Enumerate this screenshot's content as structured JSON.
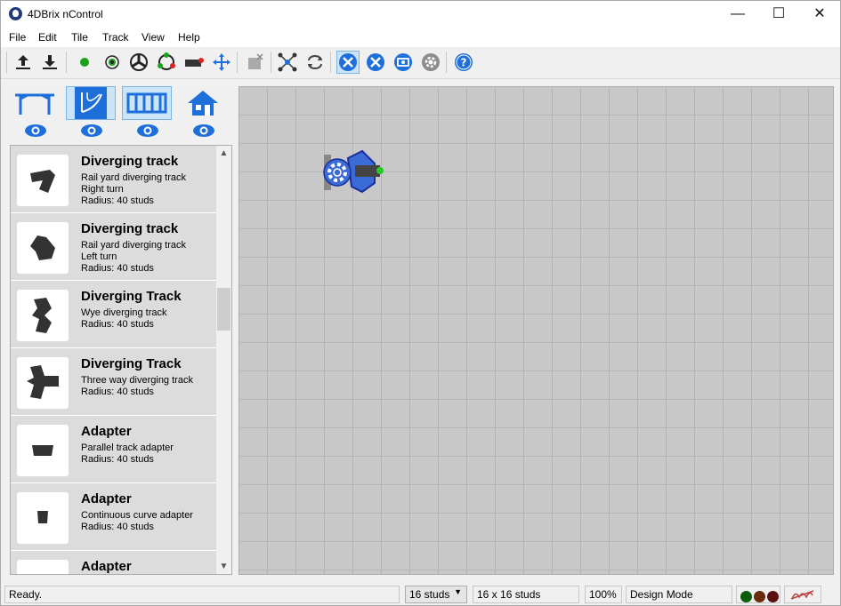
{
  "window": {
    "title": "4DBrix nControl",
    "minimize": "—",
    "maximize": "☐",
    "close": "✕"
  },
  "menu": {
    "file": "File",
    "edit": "Edit",
    "tile": "Tile",
    "track": "Track",
    "view": "View",
    "help": "Help"
  },
  "toolbar": {
    "icons": [
      "upload-icon",
      "download-icon",
      "green-dot-icon",
      "sensor-icon",
      "turntable-icon",
      "loop-icon",
      "train-icon",
      "move-icon",
      "delete-icon",
      "network-icon",
      "cycle-icon",
      "design-mode-icon",
      "tools-icon",
      "screen-icon",
      "settings-icon",
      "help-icon"
    ]
  },
  "categories": [
    {
      "name": "bridges",
      "selected": false
    },
    {
      "name": "curves",
      "selected": true
    },
    {
      "name": "straights",
      "selected": true
    },
    {
      "name": "buildings",
      "selected": false
    }
  ],
  "tiles": [
    {
      "title": "Diverging track",
      "line1": "Rail yard diverging track",
      "line2": "Right turn",
      "line3": "Radius: 40 studs"
    },
    {
      "title": "Diverging track",
      "line1": "Rail yard diverging track",
      "line2": "Left turn",
      "line3": "Radius: 40 studs"
    },
    {
      "title": "Diverging Track",
      "line1": "Wye diverging track",
      "line2": "Radius: 40 studs",
      "line3": ""
    },
    {
      "title": "Diverging Track",
      "line1": "Three way diverging track",
      "line2": "Radius: 40 studs",
      "line3": ""
    },
    {
      "title": "Adapter",
      "line1": "Parallel track adapter",
      "line2": "Radius: 40 studs",
      "line3": ""
    },
    {
      "title": "Adapter",
      "line1": "Continuous curve adapter",
      "line2": "Radius: 40 studs",
      "line3": ""
    },
    {
      "title": "Adapter",
      "line1": "",
      "line2": "",
      "line3": ""
    }
  ],
  "status": {
    "message": "Ready.",
    "grid_select": "16 studs",
    "grid_size": "16 x 16 studs",
    "zoom": "100%",
    "mode": "Design Mode"
  },
  "colors": {
    "accent": "#1e6fd9",
    "light1": "#0b5d0b",
    "light2": "#6b2a0a",
    "light3": "#5a1010"
  }
}
